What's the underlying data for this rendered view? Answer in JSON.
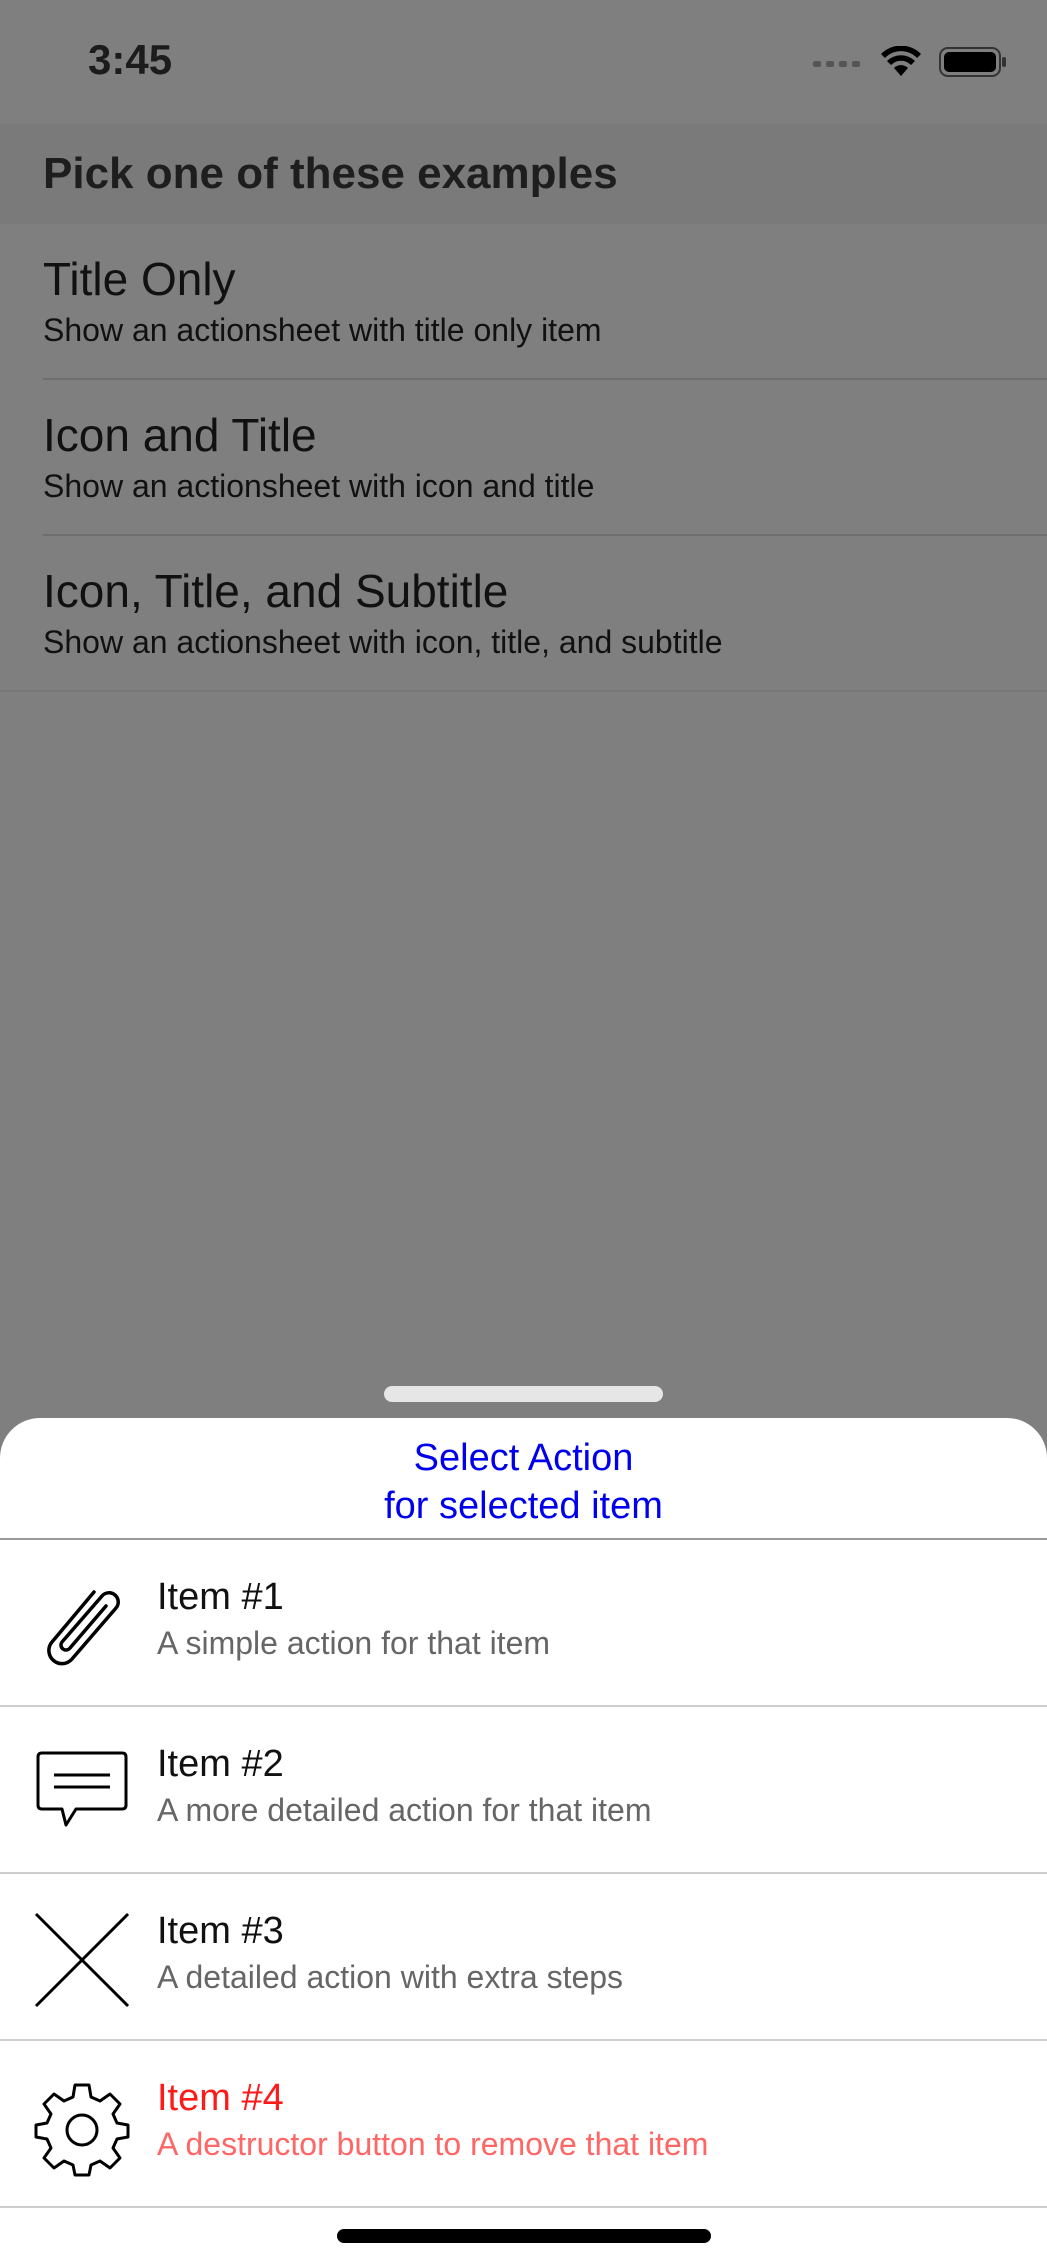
{
  "status_bar": {
    "time": "3:45",
    "icons": [
      "cellular-dots-icon",
      "wifi-icon",
      "battery-icon"
    ]
  },
  "section_header": "Pick one of these examples",
  "examples": [
    {
      "title": "Title Only",
      "subtitle": "Show an actionsheet with title only item"
    },
    {
      "title": "Icon and Title",
      "subtitle": "Show an actionsheet with icon and title"
    },
    {
      "title": "Icon, Title, and Subtitle",
      "subtitle": "Show an actionsheet with icon, title, and subtitle"
    }
  ],
  "action_sheet": {
    "title_line1": "Select Action",
    "title_line2": "for selected item",
    "title_color": "#0000ee",
    "destructive_color": "#ff1a1a",
    "items": [
      {
        "icon": "paperclip-icon",
        "title": "Item #1",
        "subtitle": "A simple action for that item"
      },
      {
        "icon": "message-bubble-icon",
        "title": "Item #2",
        "subtitle": "A more detailed action for that item"
      },
      {
        "icon": "close-icon",
        "title": "Item #3",
        "subtitle": "A detailed action with extra steps"
      },
      {
        "icon": "gear-icon",
        "title": "Item #4",
        "subtitle": "A destructor button to remove that item",
        "destructive": true
      }
    ]
  }
}
